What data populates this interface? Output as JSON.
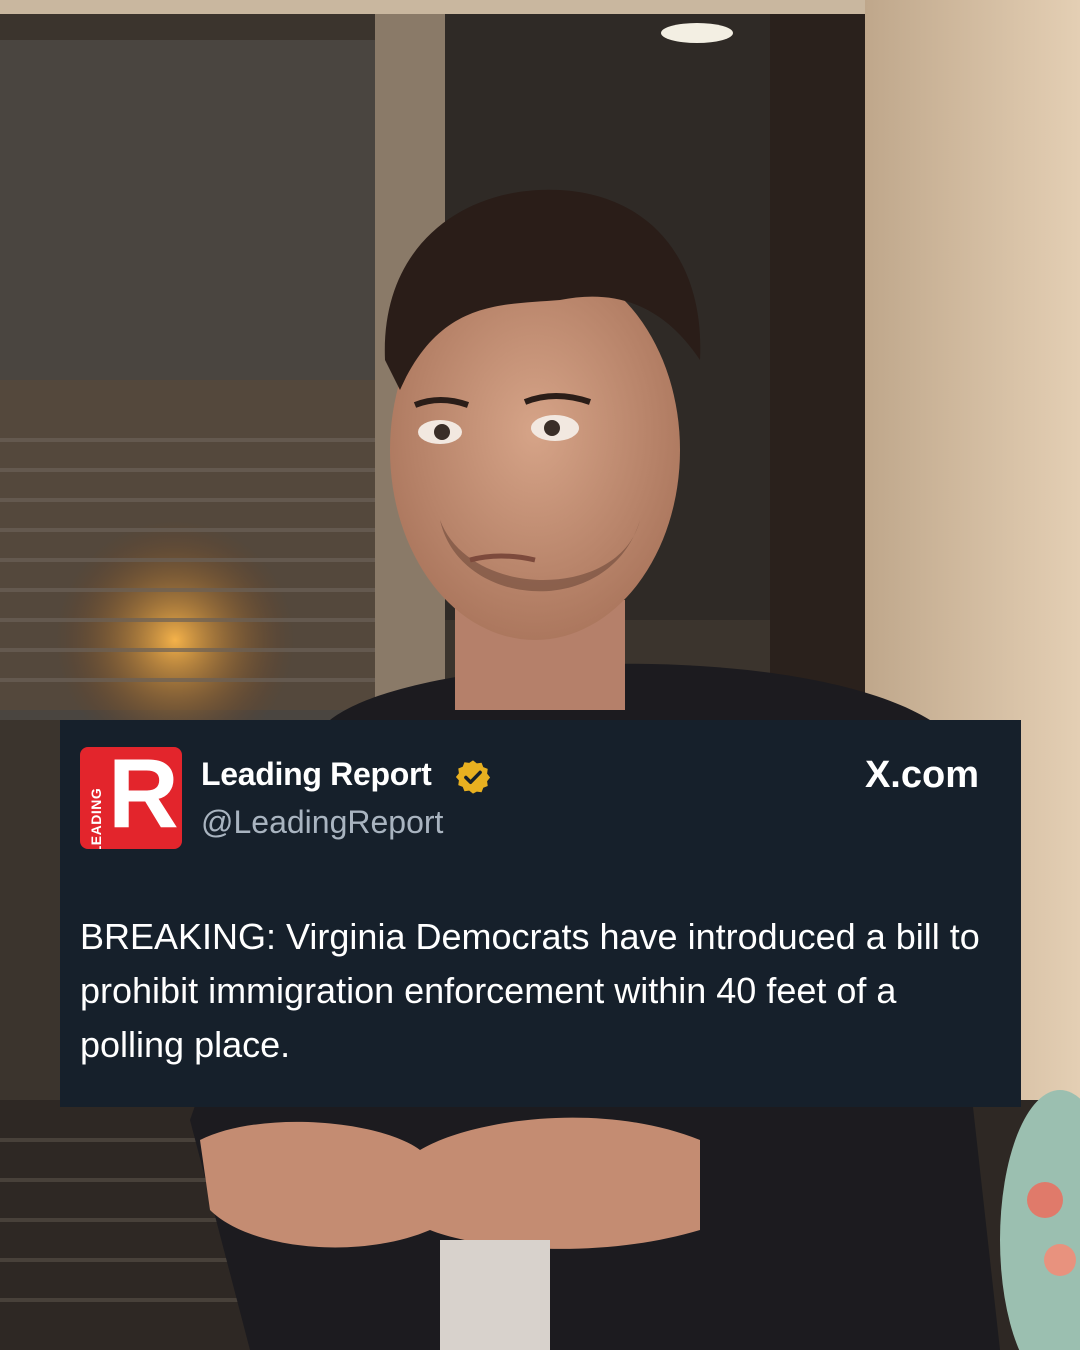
{
  "tweet": {
    "logo_letter": "R",
    "logo_side_text": "LEADING",
    "account_name": "Leading Report",
    "handle": "@LeadingReport",
    "source": "X.com",
    "text": "BREAKING: Virginia Democrats have introduced a bill to prohibit immigration enforcement within 40 feet of a polling place."
  },
  "colors": {
    "card_background": "#16202b",
    "logo_red": "#e3252c",
    "verified_gold": "#e8b020",
    "handle_gray": "#a9b4c0"
  },
  "icons": [
    "verified-badge-icon"
  ]
}
